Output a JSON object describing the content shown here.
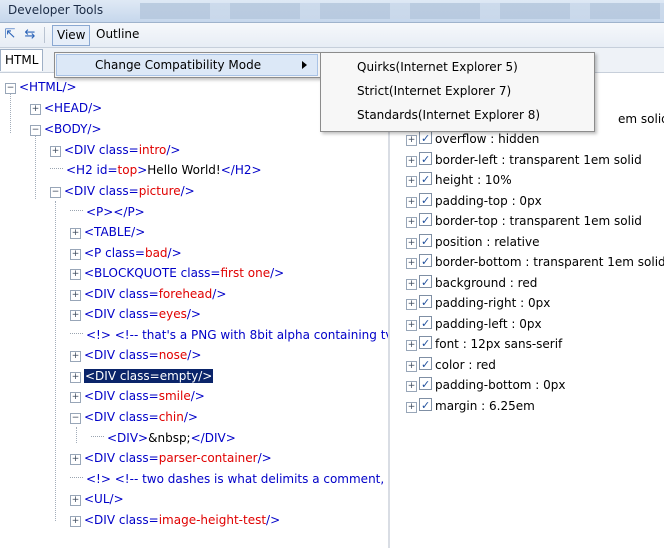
{
  "window": {
    "title": "Developer Tools"
  },
  "menubar": {
    "view": "View",
    "outline": "Outline"
  },
  "tabs": {
    "html": "HTML"
  },
  "view_menu": {
    "items": [
      {
        "label": "Change Compatibility Mode"
      }
    ]
  },
  "compat_submenu": {
    "items": [
      {
        "label": "Quirks(Internet Explorer 5)"
      },
      {
        "label": "Strict(Internet Explorer 7)"
      },
      {
        "label": "Standards(Internet Explorer 8)"
      }
    ]
  },
  "dom_tree": {
    "html": "<HTML/>",
    "head": "<HEAD/>",
    "body": "<BODY/>",
    "div_intro": {
      "tag": "<DIV class=",
      "val": "intro",
      "end": "/>"
    },
    "h2": {
      "tag": "<H2 id=",
      "val": "top",
      "mid": ">",
      "text": "Hello World!",
      "end": "</H2>"
    },
    "div_picture": {
      "tag": "<DIV class=",
      "val": "picture",
      "end": "/>"
    },
    "p_empty": "<P></P>",
    "table": "<TABLE/>",
    "p_bad": {
      "tag": "<P class=",
      "val": "bad",
      "end": "/>"
    },
    "blockquote": {
      "tag": "<BLOCKQUOTE class=",
      "val": "first one",
      "end": "/>"
    },
    "div_forehead": {
      "tag": "<DIV class=",
      "val": "forehead",
      "end": "/>"
    },
    "div_eyes": {
      "tag": "<DIV class=",
      "val": "eyes",
      "end": "/>"
    },
    "comment_png": {
      "tag": "<!>",
      "text": "<!-- that's a PNG with 8bit alpha containing tv"
    },
    "div_nose": {
      "tag": "<DIV class=",
      "val": "nose",
      "end": "/>"
    },
    "div_empty": {
      "tag": "<DIV class=",
      "val": "empty",
      "end": "/>"
    },
    "div_smile": {
      "tag": "<DIV class=",
      "val": "smile",
      "end": "/>"
    },
    "div_chin": {
      "tag": "<DIV class=",
      "val": "chin",
      "end": "/>"
    },
    "div_nbsp": {
      "tag": "<DIV>",
      "text": "&nbsp;",
      "end": "</DIV>"
    },
    "div_parser": {
      "tag": "<DIV class=",
      "val": "parser-container",
      "end": "/>"
    },
    "comment_dashes": {
      "tag": "<!>",
      "text": "<!-- two dashes is what delimits a comment, s"
    },
    "ul": "<UL/>",
    "div_image_height": {
      "tag": "<DIV class=",
      "val": "image-height-test",
      "end": "/>"
    }
  },
  "style_panel": {
    "partial_top": "em solid",
    "properties": [
      "overflow : hidden",
      "border-left : transparent 1em solid",
      "height : 10%",
      "padding-top : 0px",
      "border-top : transparent 1em solid",
      "position : relative",
      "border-bottom : transparent 1em solid",
      "background : red",
      "padding-right : 0px",
      "padding-left : 0px",
      "font : 12px sans-serif",
      "color : red",
      "padding-bottom : 0px",
      "margin : 6.25em"
    ]
  },
  "colors": {
    "tag": "#0000c8",
    "attr_value": "#e00000",
    "selection": "#0a246a"
  }
}
